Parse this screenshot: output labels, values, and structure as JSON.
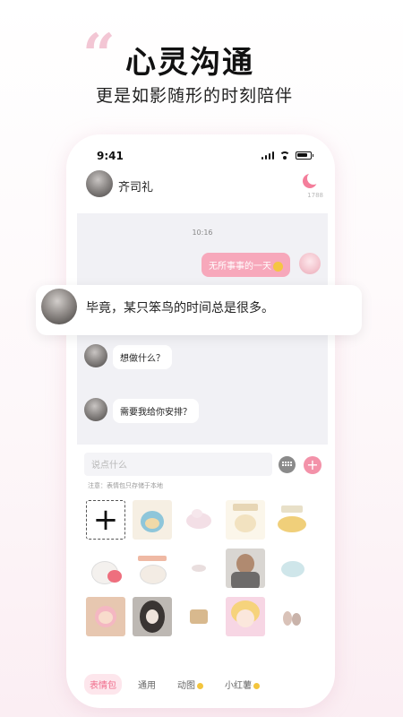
{
  "promo": {
    "quote_glyph": "“",
    "headline": "心灵沟通",
    "subline": "更是如影随形的时刻陪伴"
  },
  "status_bar": {
    "time": "9:41"
  },
  "chat_header": {
    "contact_name": "齐司礼",
    "count": "1788"
  },
  "chat": {
    "timestamp": "10:16",
    "outgoing": "无所事事的一天",
    "incoming": [
      "毕竟，某只笨鸟的时间总是很多。",
      "想做什么？",
      "需要我给你安排？"
    ]
  },
  "composer": {
    "placeholder": "说点什么",
    "note": "注意：表情包只存储于本地",
    "plus_label": "+"
  },
  "sticker_panel": {
    "add_label": "+"
  },
  "tabs": [
    {
      "label": "表情包",
      "active": true
    },
    {
      "label": "通用"
    },
    {
      "label": "动图"
    },
    {
      "label": "小红薯"
    }
  ],
  "colors": {
    "accent_pink": "#f392a9",
    "bubble_pink": "#f7a8bb",
    "chat_bg": "#f1f1f5"
  }
}
